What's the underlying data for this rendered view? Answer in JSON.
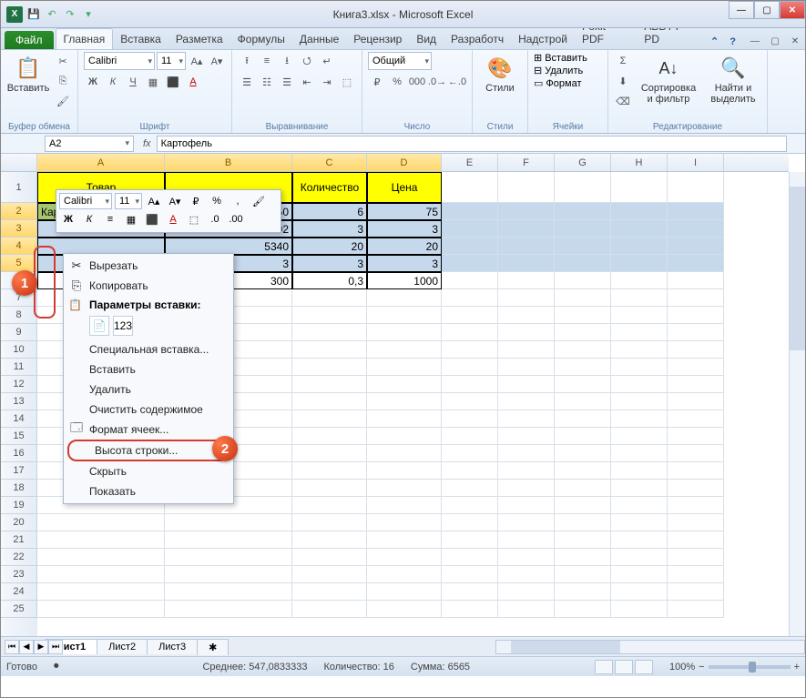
{
  "title": "Книга3.xlsx - Microsoft Excel",
  "qat": {
    "save": "💾",
    "undo": "↶",
    "redo": "↷"
  },
  "tabs": {
    "file": "Файл",
    "items": [
      "Главная",
      "Вставка",
      "Разметка",
      "Формулы",
      "Данные",
      "Рецензир",
      "Вид",
      "Разработч",
      "Надстрой",
      "Foxit PDF",
      "ABBYY PD"
    ]
  },
  "ribbon": {
    "clipboard": {
      "label": "Буфер обмена",
      "paste": "Вставить"
    },
    "font": {
      "label": "Шрифт",
      "name": "Calibri",
      "size": "11"
    },
    "align": {
      "label": "Выравнивание"
    },
    "number": {
      "label": "Число",
      "format": "Общий"
    },
    "styles": {
      "label": "Стили",
      "btn": "Стили"
    },
    "cells": {
      "label": "Ячейки",
      "insert": "Вставить",
      "delete": "Удалить",
      "format": "Формат"
    },
    "editing": {
      "label": "Редактирование",
      "sort": "Сортировка\nи фильтр",
      "find": "Найти и\nвыделить"
    }
  },
  "namebox": "A2",
  "formula": "Картофель",
  "columns": [
    "A",
    "B",
    "C",
    "D",
    "E",
    "F",
    "G",
    "H",
    "I"
  ],
  "header_row": {
    "A": "Товар",
    "B": "",
    "C": "Количество",
    "D": "Цена"
  },
  "data_rows": [
    {
      "A": "Картофель",
      "B": "450",
      "C": "6",
      "D": "75"
    },
    {
      "A": "",
      "B": "492",
      "C": "3",
      "D": "3"
    },
    {
      "A": "",
      "B": "5340",
      "C": "20",
      "D": "20"
    },
    {
      "A": "",
      "B": "3",
      "C": "3",
      "D": "3"
    },
    {
      "A": "",
      "B": "300",
      "C": "0,3",
      "D": "1000"
    }
  ],
  "mini": {
    "font": "Calibri",
    "size": "11"
  },
  "ctx": {
    "cut": "Вырезать",
    "copy": "Копировать",
    "paste_opts": "Параметры вставки:",
    "paste_special": "Специальная вставка...",
    "insert": "Вставить",
    "delete": "Удалить",
    "clear": "Очистить содержимое",
    "format_cells": "Формат ячеек...",
    "row_height": "Высота строки...",
    "hide": "Скрыть",
    "show": "Показать"
  },
  "callouts": {
    "one": "1",
    "two": "2"
  },
  "sheets": [
    "Лист1",
    "Лист2",
    "Лист3"
  ],
  "status": {
    "ready": "Готово",
    "avg": "Среднее: 547,0833333",
    "count": "Количество: 16",
    "sum": "Сумма: 6565",
    "zoom": "100%"
  }
}
